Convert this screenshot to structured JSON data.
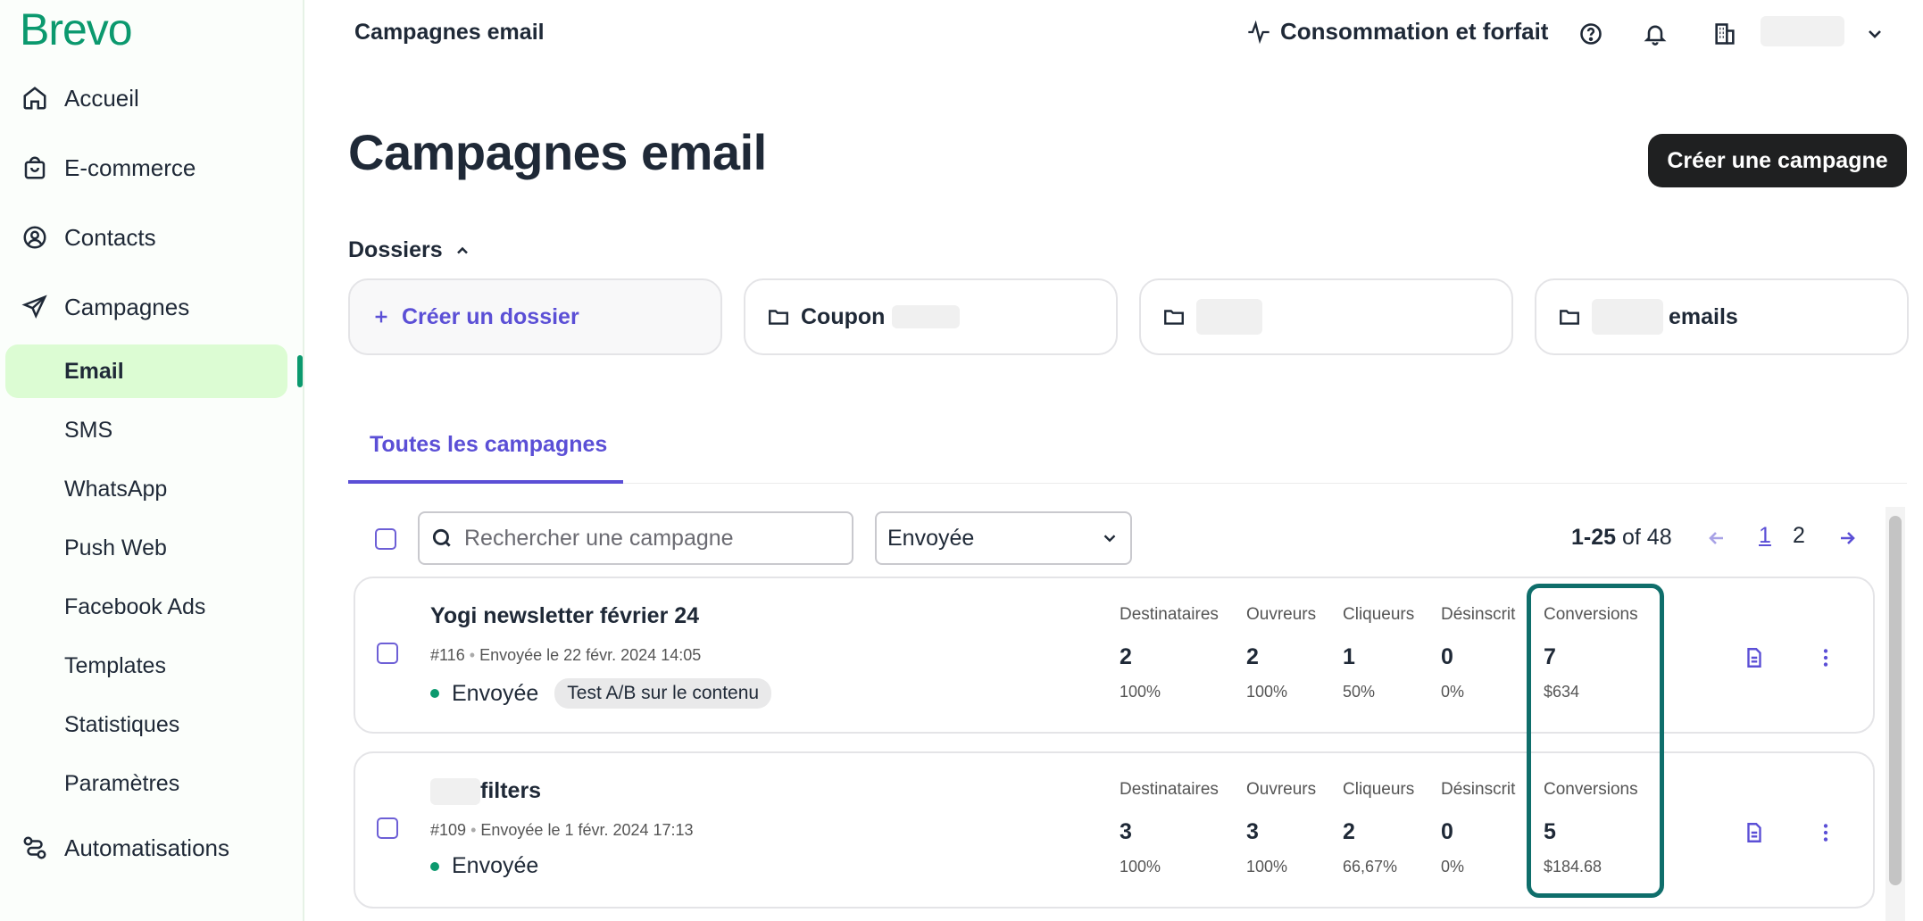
{
  "app": {
    "logo": "Brevo"
  },
  "sidebar": {
    "items": [
      {
        "label": "Accueil",
        "icon": "home-icon"
      },
      {
        "label": "E-commerce",
        "icon": "shopping-bag-icon"
      },
      {
        "label": "Contacts",
        "icon": "user-circle-icon"
      },
      {
        "label": "Campagnes",
        "icon": "paper-plane-icon"
      }
    ],
    "sub_items": [
      "Email",
      "SMS",
      "WhatsApp",
      "Push Web",
      "Facebook Ads",
      "Templates",
      "Statistiques",
      "Paramètres"
    ],
    "active": "Email",
    "automations": {
      "label": "Automatisations",
      "icon": "automation-icon"
    }
  },
  "topbar": {
    "title": "Campagnes email",
    "consumption": "Consommation et forfait",
    "icons": [
      "help-icon",
      "bell-icon",
      "building-icon",
      "chevron-down-icon"
    ]
  },
  "main": {
    "title": "Campagnes email",
    "create_button": "Créer une campagne",
    "folders_label": "Dossiers",
    "folders": {
      "create": "Créer un dossier",
      "coupon": "Coupon",
      "emails": "emails"
    },
    "tab": "Toutes les campagnes",
    "search_placeholder": "Rechercher une campagne",
    "status_filter": "Envoyée",
    "pagination": {
      "range": "1-25",
      "of": "of 48",
      "pages": [
        "1",
        "2"
      ],
      "current": "1"
    }
  },
  "campaigns": [
    {
      "name": "Yogi newsletter février 24",
      "id": "#116",
      "sent": "Envoyée le 22 févr. 2024 14:05",
      "status": "Envoyée",
      "badge": "Test A/B sur le contenu",
      "stats": [
        {
          "label": "Destinataires",
          "value": "2",
          "pct": "100%"
        },
        {
          "label": "Ouvreurs",
          "value": "2",
          "pct": "100%"
        },
        {
          "label": "Cliqueurs",
          "value": "1",
          "pct": "50%"
        },
        {
          "label": "Désinscrit",
          "value": "0",
          "pct": "0%"
        },
        {
          "label": "Conversions",
          "value": "7",
          "pct": "$634"
        }
      ]
    },
    {
      "name": "filters",
      "id": "#109",
      "sent": "Envoyée le 1 févr. 2024 17:13",
      "status": "Envoyée",
      "stats": [
        {
          "label": "Destinataires",
          "value": "3",
          "pct": "100%"
        },
        {
          "label": "Ouvreurs",
          "value": "3",
          "pct": "100%"
        },
        {
          "label": "Cliqueurs",
          "value": "2",
          "pct": "66,67%"
        },
        {
          "label": "Désinscrit",
          "value": "0",
          "pct": "0%"
        },
        {
          "label": "Conversions",
          "value": "5",
          "pct": "$184.68"
        }
      ]
    }
  ],
  "colors": {
    "brand": "#0b996e",
    "accent": "#5b4fd6",
    "active_bg": "#dcfcd3",
    "highlight": "#0f6e6b"
  }
}
